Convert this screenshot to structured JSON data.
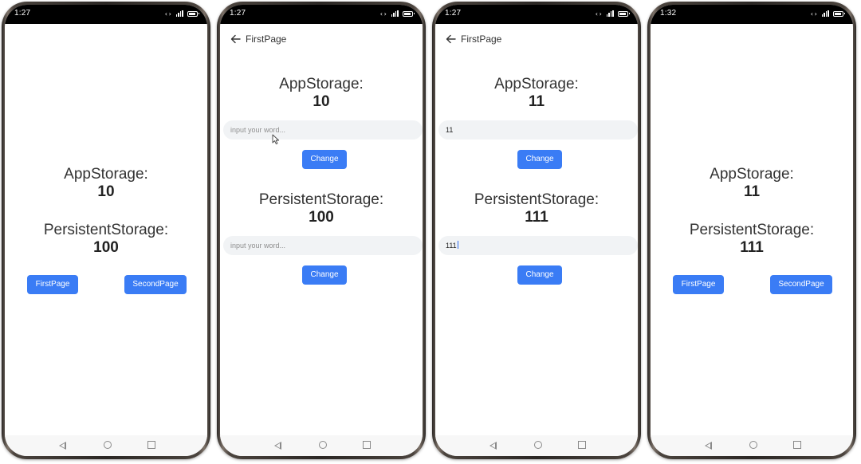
{
  "colors": {
    "accent": "#3a7cf5",
    "input_bg": "#f1f3f5",
    "text": "#333333",
    "status_bar": "#000000"
  },
  "screens": [
    {
      "status_time": "1:27",
      "app_storage_label": "AppStorage:",
      "app_storage_value": "10",
      "persistent_storage_label": "PersistentStorage:",
      "persistent_storage_value": "100",
      "first_page_button": "FirstPage",
      "second_page_button": "SecondPage"
    },
    {
      "status_time": "1:27",
      "title": "FirstPage",
      "app_storage_label": "AppStorage:",
      "app_storage_value": "10",
      "input1": {
        "value": "",
        "placeholder": "input your word..."
      },
      "change1_button": "Change",
      "persistent_storage_label": "PersistentStorage:",
      "persistent_storage_value": "100",
      "input2": {
        "value": "",
        "placeholder": "input your word..."
      },
      "change2_button": "Change"
    },
    {
      "status_time": "1:27",
      "title": "FirstPage",
      "app_storage_label": "AppStorage:",
      "app_storage_value": "11",
      "input1": {
        "value": "11",
        "placeholder": "input your word..."
      },
      "change1_button": "Change",
      "persistent_storage_label": "PersistentStorage:",
      "persistent_storage_value": "111",
      "input2": {
        "value": "111",
        "placeholder": "input your word..."
      },
      "change2_button": "Change"
    },
    {
      "status_time": "1:32",
      "app_storage_label": "AppStorage:",
      "app_storage_value": "11",
      "persistent_storage_label": "PersistentStorage:",
      "persistent_storage_value": "111",
      "first_page_button": "FirstPage",
      "second_page_button": "SecondPage"
    }
  ]
}
